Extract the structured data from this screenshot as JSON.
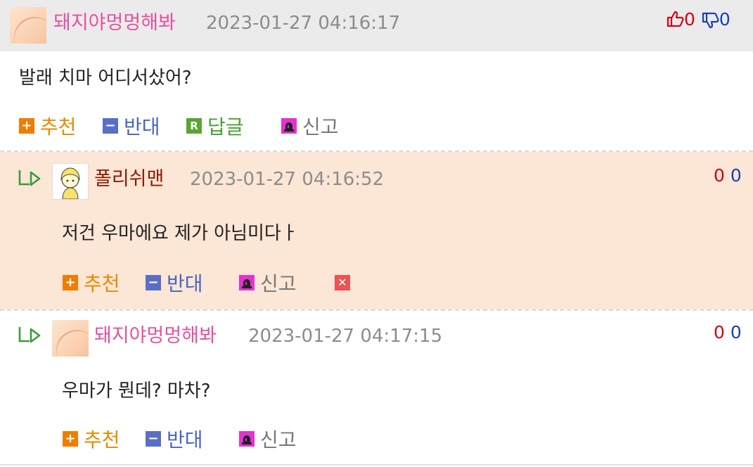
{
  "comments": [
    {
      "nickname": "돼지야멍멍해봐",
      "datetime": "2023-01-27 04:16:17",
      "up_count": "0",
      "down_count": "0",
      "text": "발래 치마 어디서샀어?",
      "actions": {
        "recommend": "추천",
        "oppose": "반대",
        "reply": "답글",
        "report": "신고"
      }
    },
    {
      "nickname": "폴리쉬맨",
      "datetime": "2023-01-27 04:16:52",
      "up_count": "0",
      "down_count": "0",
      "text": "저건 우마에요 제가 아님미다ㅏ",
      "actions": {
        "recommend": "추천",
        "oppose": "반대",
        "report": "신고"
      }
    },
    {
      "nickname": "돼지야멍멍해봐",
      "datetime": "2023-01-27 04:17:15",
      "up_count": "0",
      "down_count": "0",
      "text": "우마가 뭔데? 마차?",
      "actions": {
        "recommend": "추천",
        "oppose": "반대",
        "report": "신고"
      }
    }
  ],
  "icons": {
    "thumbs_up": "thumbs-up-icon",
    "thumbs_down": "thumbs-down-icon",
    "reply_arrow": "reply-arrow-icon",
    "plus": "plus-icon",
    "minus": "minus-icon",
    "reply_r": "reply-r-icon",
    "report": "siren-icon",
    "delete": "close-icon"
  },
  "colors": {
    "nick_pink": "#e84fa0",
    "nick_brown": "#8a1b00",
    "up": "#d0021b",
    "down": "#1a3fb5",
    "reply_bg": "#fce6d6",
    "header_bg": "#ebebeb"
  }
}
